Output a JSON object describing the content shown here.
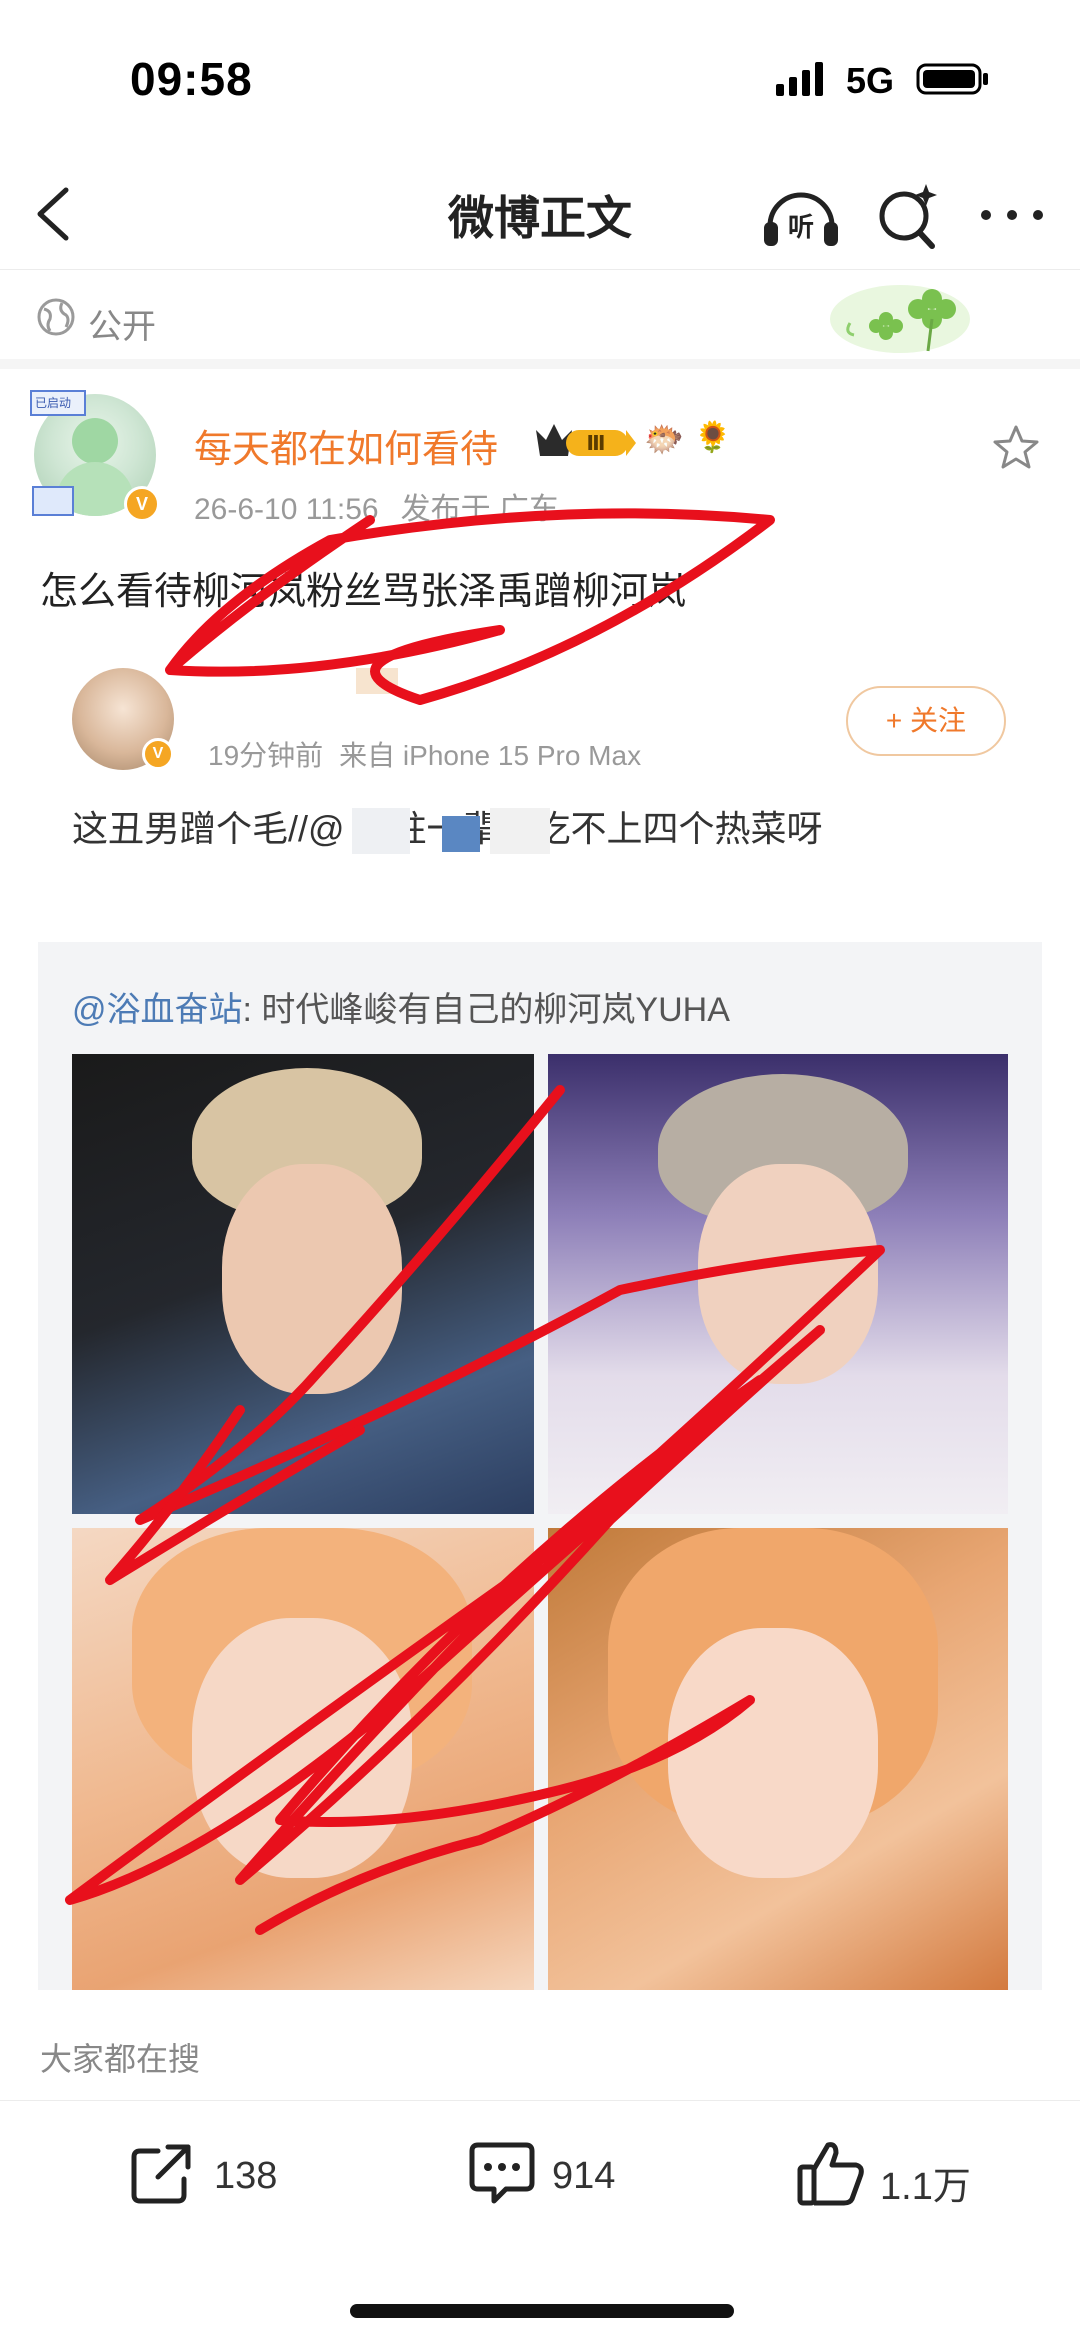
{
  "status_bar": {
    "time": "09:58",
    "network": "5G"
  },
  "nav": {
    "title": "微博正文",
    "listen_glyph": "听"
  },
  "visibility": {
    "label": "公开"
  },
  "post": {
    "author": "每天都在如何看待",
    "level": "Ⅲ",
    "date": "26-6-10 11:56",
    "location": "发布于 广东",
    "text": "怎么看待柳河岚粉丝骂张泽禹蹭柳河岚"
  },
  "avatar_window": {
    "caption": "已启动"
  },
  "verified_badge": "V",
  "repost": {
    "meta_time": "19分钟前",
    "meta_source": "来自 iPhone 15 Pro Max",
    "follow_label": "+ 关注",
    "text": "这丑男蹭个毛//@          高柱一辈子吃不上四个热菜呀",
    "quote_mention": "@浴血奋站",
    "quote_text": ": 时代峰峻有自己的柳河岚YUHA"
  },
  "trending": {
    "label": "大家都在搜"
  },
  "actions": {
    "share_count": "138",
    "comment_count": "914",
    "like_count": "1.1万"
  },
  "colors": {
    "accent_orange": "#f0792b",
    "mention_blue": "#4d7bb5",
    "scribble_red": "#e8101c"
  }
}
